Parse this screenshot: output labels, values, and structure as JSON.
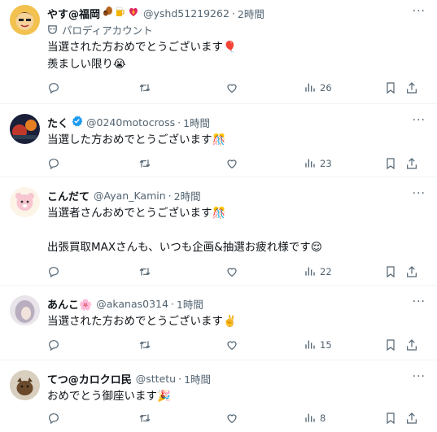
{
  "tweets": [
    {
      "name": "やす@福岡",
      "handle": "@yshd51219262",
      "time": "2時間",
      "parody_label": "パロディアカウント",
      "text": "当選された方おめでとうございます🎈\n羨ましい限り😭",
      "views": "26"
    },
    {
      "name": "たく",
      "verified": true,
      "handle": "@0240motocross",
      "time": "1時間",
      "text": "当選した方おめでとうございます🎊",
      "views": "23"
    },
    {
      "name": "こんだて",
      "handle": "@Ayan_Kamin",
      "time": "2時間",
      "text": "当選者さんおめでとうございます🎊\n\n出張買取MAXさんも、いつも企画&抽選お疲れ様です😌",
      "views": "22"
    },
    {
      "name": "あんこ🌸",
      "handle": "@akanas0314",
      "time": "1時間",
      "text": "当選された方おめでとうございます✌️",
      "views": "15"
    },
    {
      "name": "てつ@カロクロ民",
      "handle": "@sttetu",
      "time": "1時間",
      "text": "おめでとう御座います🎉",
      "views": "8"
    }
  ],
  "separator": "·",
  "icons": [
    "reply-icon",
    "retweet-icon",
    "like-icon",
    "views-icon",
    "bookmark-icon",
    "share-icon",
    "more-icon",
    "verified-badge-icon",
    "parody-mask-icon"
  ],
  "colors": {
    "text": "#0f1419",
    "secondary": "#536471",
    "verified": "#1d9bf0",
    "divider": "#eff3f4"
  }
}
